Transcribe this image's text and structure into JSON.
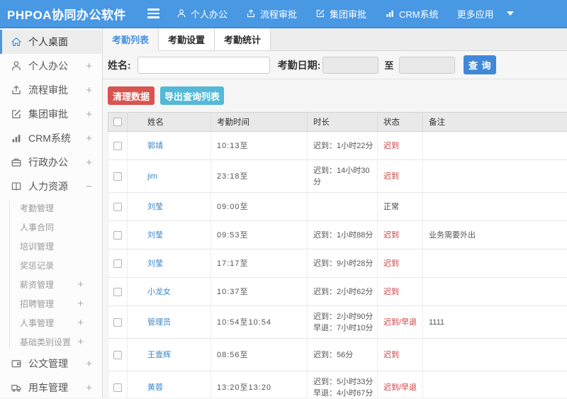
{
  "topbar": {
    "title": "PHPOA协同办公软件",
    "nav": [
      {
        "label": "个人办公",
        "icon": "person-icon"
      },
      {
        "label": "流程审批",
        "icon": "workflow-icon"
      },
      {
        "label": "集团审批",
        "icon": "edit-icon"
      },
      {
        "label": "CRM系统",
        "icon": "chart-icon"
      },
      {
        "label": "更多应用",
        "icon": "caret-down-icon"
      }
    ]
  },
  "sidebar": {
    "items_top": [
      {
        "id": "desktop",
        "label": "个人桌面",
        "icon": "home-icon",
        "active": true,
        "expand": ""
      },
      {
        "id": "personal-office",
        "label": "个人办公",
        "icon": "person-icon",
        "expand": "+"
      },
      {
        "id": "workflow-approval",
        "label": "流程审批",
        "icon": "workflow-icon",
        "expand": "+"
      },
      {
        "id": "group-approval",
        "label": "集团审批",
        "icon": "edit-icon",
        "expand": "+"
      },
      {
        "id": "crm-system",
        "label": "CRM系统",
        "icon": "chart-icon",
        "expand": "+"
      },
      {
        "id": "admin-office",
        "label": "行政办公",
        "icon": "briefcase-icon",
        "expand": "+"
      },
      {
        "id": "human-resources",
        "label": "人力资源",
        "icon": "book-icon",
        "expand": "−"
      }
    ],
    "submenu": [
      {
        "id": "attendance-management",
        "label": "考勤管理",
        "expand": ""
      },
      {
        "id": "hr-contract",
        "label": "人事合同",
        "expand": ""
      },
      {
        "id": "training-management",
        "label": "培训管理",
        "expand": ""
      },
      {
        "id": "reward-punishment",
        "label": "奖惩记录",
        "expand": ""
      },
      {
        "id": "salary-management",
        "label": "薪资管理",
        "expand": "+"
      },
      {
        "id": "recruit-management",
        "label": "招聘管理",
        "expand": "+"
      },
      {
        "id": "personnel-management",
        "label": "人事管理",
        "expand": "+"
      },
      {
        "id": "base-category-settings",
        "label": "基础类别设置",
        "expand": "+"
      }
    ],
    "items_bottom": [
      {
        "id": "document-management",
        "label": "公文管理",
        "icon": "wallet-icon",
        "expand": "+"
      },
      {
        "id": "vehicle-management",
        "label": "用车管理",
        "icon": "truck-icon",
        "expand": "+"
      }
    ]
  },
  "tabs": [
    {
      "label": "考勤列表",
      "active": true
    },
    {
      "label": "考勤设置",
      "active": false
    },
    {
      "label": "考勤统计",
      "active": false
    }
  ],
  "filter": {
    "name_label": "姓名:",
    "name_value": "",
    "date_label": "考勤日期:",
    "date_from_value": "",
    "to_label": "至",
    "date_to_value": "",
    "search_button": "查 询"
  },
  "actions": {
    "clear_button": "清理数据",
    "export_button": "导出查询列表"
  },
  "table": {
    "headers": [
      "姓名",
      "考勤时间",
      "时长",
      "状态",
      "备注"
    ],
    "rows": [
      {
        "name": "郭靖",
        "time": "10:13至",
        "duration": "迟到：1小时22分",
        "status": "迟到",
        "status_type": "late",
        "note": "",
        "tall": false
      },
      {
        "name": "jim",
        "time": "23:18至",
        "duration": "迟到：14小时30分",
        "status": "迟到",
        "status_type": "late",
        "note": "",
        "tall": true
      },
      {
        "name": "刘莹",
        "time": "09:00至",
        "duration": "",
        "status": "正常",
        "status_type": "normal",
        "note": "",
        "tall": false
      },
      {
        "name": "刘莹",
        "time": "09:53至",
        "duration": "迟到：1小时88分",
        "status": "迟到",
        "status_type": "late",
        "note": "业务需要外出",
        "tall": false
      },
      {
        "name": "刘莹",
        "time": "17:17至",
        "duration": "迟到：9小时28分",
        "status": "迟到",
        "status_type": "late",
        "note": "",
        "tall": false
      },
      {
        "name": "小龙女",
        "time": "10:37至",
        "duration": "迟到：2小时62分",
        "status": "迟到",
        "status_type": "late",
        "note": "",
        "tall": false
      },
      {
        "name": "管理员",
        "time": "10:54至10:54",
        "duration": "迟到：2小时90分\n早退：7小时10分",
        "status": "迟到/早退",
        "status_type": "late",
        "note": "1111",
        "tall": true
      },
      {
        "name": "王壹辉",
        "time": "08:56至",
        "duration": "迟到：56分",
        "status": "迟到",
        "status_type": "late",
        "note": "",
        "tall": true
      },
      {
        "name": "黄蓉",
        "time": "13:20至13:20",
        "duration": "迟到：5小时33分\n早退：4小时67分",
        "status": "迟到/早退",
        "status_type": "late",
        "note": "",
        "tall": true
      }
    ]
  },
  "colors": {
    "topbar_blue": "#4898e4",
    "link_blue": "#3a86c8",
    "status_red": "#cb4043",
    "danger_button_red": "#d9534f",
    "info_button_blue": "#54b8d8",
    "search_button_blue": "#4189d8"
  }
}
